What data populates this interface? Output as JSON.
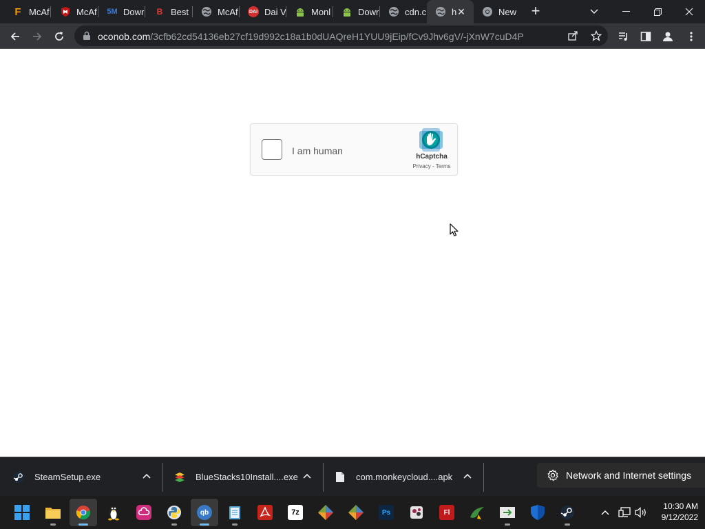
{
  "tabs": [
    {
      "title": "McAf",
      "favicon": "f-icon",
      "color": "#f29900",
      "glyph": "F",
      "active": false
    },
    {
      "title": "McAf",
      "favicon": "mcafee-shield-icon",
      "color": "#c01818",
      "glyph": "",
      "active": false
    },
    {
      "title": "Dowr",
      "favicon": "5m-icon",
      "color": "#3c7bd6",
      "glyph": "5M",
      "active": false
    },
    {
      "title": "Best",
      "favicon": "b-icon",
      "color": "#e53935",
      "glyph": "B",
      "active": false
    },
    {
      "title": "McAf",
      "favicon": "globe-icon",
      "color": "#9aa0a6",
      "glyph": "",
      "active": false
    },
    {
      "title": "Dai V",
      "favicon": "red-badge-icon",
      "color": "#d32f2f",
      "glyph": "",
      "active": false
    },
    {
      "title": "Monl",
      "favicon": "android-icon",
      "color": "#8bc34a",
      "glyph": "",
      "active": false
    },
    {
      "title": "Dowr",
      "favicon": "android-icon",
      "color": "#8bc34a",
      "glyph": "",
      "active": false
    },
    {
      "title": "cdn.c",
      "favicon": "globe-icon",
      "color": "#9aa0a6",
      "glyph": "",
      "active": false
    },
    {
      "title": "h",
      "favicon": "globe-icon",
      "color": "#9aa0a6",
      "glyph": "",
      "active": true
    },
    {
      "title": "New",
      "favicon": "chrome-icon",
      "color": "#9aa0a6",
      "glyph": "",
      "active": false
    }
  ],
  "address": {
    "host": "oconob.com",
    "path": "/3cfb62cd54136eb27cf19d992c18a1b0dUAQreH1YUU9jEip/fCv9Jhv6gV/-jXnW7cuD4P"
  },
  "captcha": {
    "label": "I am human",
    "brand": "hCaptcha",
    "privacy": "Privacy",
    "dash": " - ",
    "terms": "Terms"
  },
  "downloads": [
    {
      "name": "SteamSetup.exe",
      "icon": "steam-icon"
    },
    {
      "name": "BlueStacks10Install....exe",
      "icon": "bluestacks-icon"
    },
    {
      "name": "com.monkeycloud....apk",
      "icon": "file-icon"
    }
  ],
  "network_settings": "Network and Internet settings",
  "taskbar": {
    "apps": [
      {
        "name": "start",
        "color": "#2b8cdb",
        "glyph": ""
      },
      {
        "name": "file-explorer",
        "color": "#e8b53a",
        "glyph": ""
      },
      {
        "name": "chrome",
        "color": "#e14b3b",
        "glyph": ""
      },
      {
        "name": "tux",
        "color": "#222222",
        "glyph": ""
      },
      {
        "name": "creative-cloud",
        "color": "#da3b63",
        "glyph": ""
      },
      {
        "name": "python",
        "color": "#4a89c8",
        "glyph": ""
      },
      {
        "name": "qbittorrent",
        "color": "#3a79c6",
        "glyph": "qb"
      },
      {
        "name": "notepad",
        "color": "#58a6d8",
        "glyph": ""
      },
      {
        "name": "adobe-acrobat",
        "color": "#c6241b",
        "glyph": ""
      },
      {
        "name": "7zip",
        "color": "#ffffff",
        "glyph": "7z"
      },
      {
        "name": "git",
        "color": "#7ea03c",
        "glyph": ""
      },
      {
        "name": "git-2",
        "color": "#7ea03c",
        "glyph": ""
      },
      {
        "name": "photoshop",
        "color": "#0e2640",
        "glyph": "Ps"
      },
      {
        "name": "virtualbox",
        "color": "#4a4a4a",
        "glyph": ""
      },
      {
        "name": "flash",
        "color": "#c11a1a",
        "glyph": "Fl"
      },
      {
        "name": "android-studio",
        "color": "#3e8e40",
        "glyph": ""
      },
      {
        "name": "terminal-arrow",
        "color": "#e0e0e0",
        "glyph": ""
      },
      {
        "name": "windows-security",
        "color": "#1d6fd2",
        "glyph": ""
      },
      {
        "name": "steam",
        "color": "#1b2838",
        "glyph": ""
      }
    ],
    "time": "10:30 AM",
    "date": "9/12/2022"
  }
}
